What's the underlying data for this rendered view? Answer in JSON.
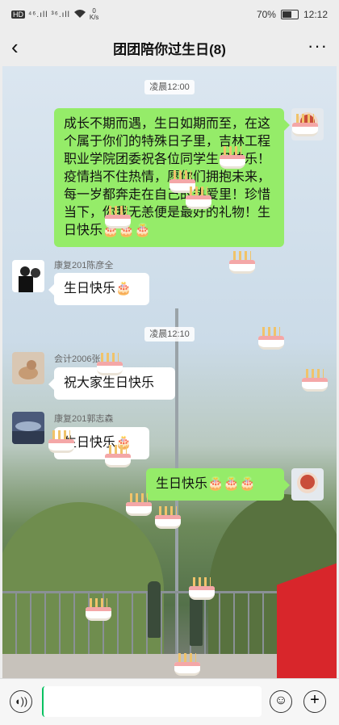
{
  "status_bar": {
    "hd": "HD",
    "signal1": "⁴⁶.ıll",
    "signal2": "³⁶.ıll",
    "speed_value": "0",
    "speed_unit": "K/s",
    "battery_percent": "70%",
    "battery_level": 0.7,
    "time": "12:12"
  },
  "nav": {
    "back_icon": "chevron-left-icon",
    "title": "团团陪你过生日(8)",
    "more_icon": "more-dots-icon"
  },
  "messages": {
    "t1": "凌晨12:00",
    "m1": "成长不期而遇，生日如期而至，在这个属于你们的特殊日子里，吉林工程职业学院团委祝各位同学生日快乐！疫情挡不住热情，愿你们拥抱未来，每一岁都奔走在自己的热爱里！珍惜当下，你我无恙便是最好的礼物！生日快乐🎂🎂🎂",
    "m2_sender": "康复201陈彦全",
    "m2": "生日快乐🎂",
    "t2": "凌晨12:10",
    "m3_sender": "会计2006张",
    "m3": "祝大家生日快乐",
    "m4_sender": "康复201郭志森",
    "m4": "生日快乐🎂",
    "m5": "生日快乐🎂🎂🎂"
  },
  "colors": {
    "my_bubble": "#95ec69",
    "other_bubble": "#ffffff"
  },
  "input": {
    "voice_icon": "voice-icon",
    "emoji_icon": "emoji-icon",
    "plus_icon": "plus-icon"
  }
}
